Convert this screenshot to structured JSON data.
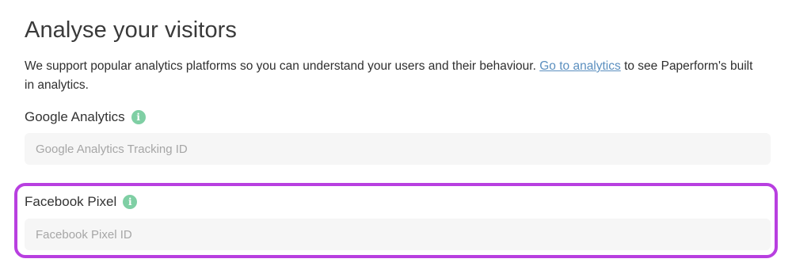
{
  "page": {
    "title": "Analyse your visitors",
    "intro_before": "We support popular analytics platforms so you can understand your users and their behaviour. ",
    "intro_link": "Go to analytics",
    "intro_after": " to see Paperform's built in analytics."
  },
  "google_analytics": {
    "label": "Google Analytics",
    "info_icon": "info-icon",
    "value": "",
    "placeholder": "Google Analytics Tracking ID"
  },
  "facebook_pixel": {
    "label": "Facebook Pixel",
    "info_icon": "info-icon",
    "value": "",
    "placeholder": "Facebook Pixel ID"
  },
  "colors": {
    "link": "#5b8fbf",
    "info_icon": "#7fcfa4",
    "highlight": "#b83fe0",
    "input_background": "#f6f6f6"
  }
}
